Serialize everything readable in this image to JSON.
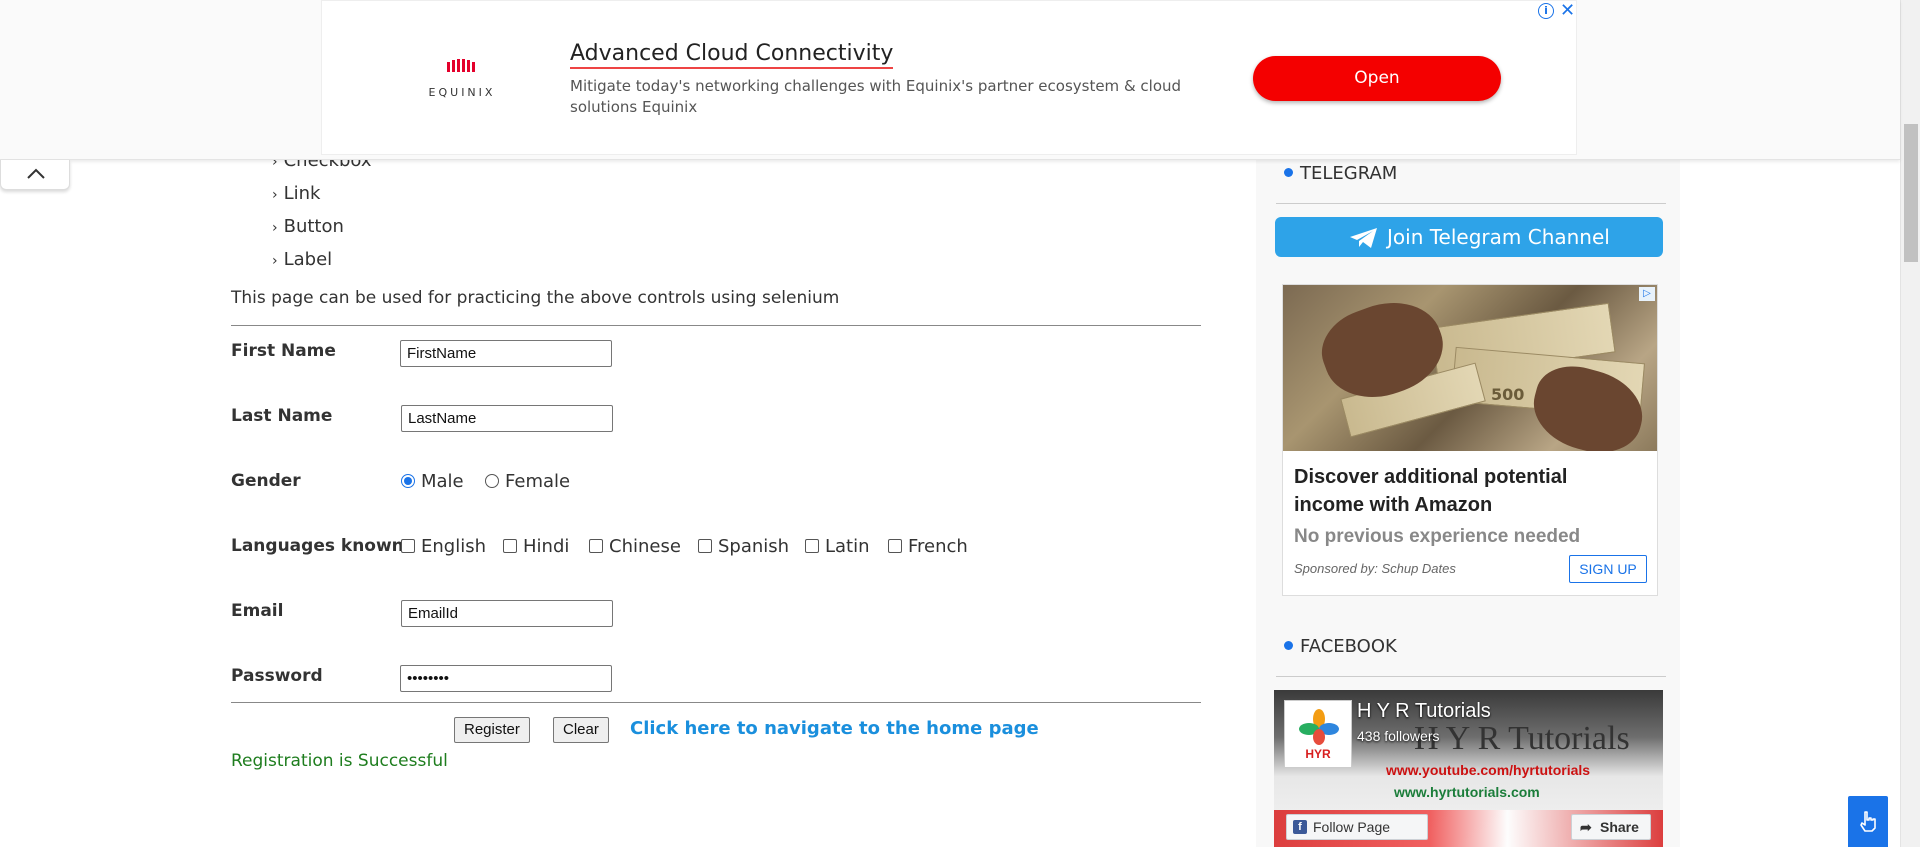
{
  "ad": {
    "logo_text": "EQUINIX",
    "title": "Advanced Cloud Connectivity",
    "description": "Mitigate today's networking challenges with Equinix's partner ecosystem & cloud solutions Equinix",
    "open_label": "Open",
    "info_glyph": "i",
    "close_glyph": "✕"
  },
  "nav_list": [
    {
      "label": "Checkbox"
    },
    {
      "label": "Link"
    },
    {
      "label": "Button"
    },
    {
      "label": "Label"
    }
  ],
  "intro": "This page can be used for practicing the above controls using selenium",
  "form": {
    "first_name_label": "First Name",
    "first_name_value": "FirstName",
    "last_name_label": "Last Name",
    "last_name_value": "LastName",
    "gender_label": "Gender",
    "gender_options": [
      {
        "label": "Male",
        "checked": true
      },
      {
        "label": "Female",
        "checked": false
      }
    ],
    "languages_label": "Languages known",
    "languages": [
      {
        "label": "English",
        "checked": false
      },
      {
        "label": "Hindi",
        "checked": false
      },
      {
        "label": "Chinese",
        "checked": false
      },
      {
        "label": "Spanish",
        "checked": false
      },
      {
        "label": "Latin",
        "checked": false
      },
      {
        "label": "French",
        "checked": false
      }
    ],
    "email_label": "Email",
    "email_value": "EmailId",
    "password_label": "Password",
    "password_value": "••••••••",
    "register_label": "Register",
    "clear_label": "Clear",
    "home_link": "Click here to navigate to the home page",
    "success_message": "Registration is Successful"
  },
  "sidebar": {
    "telegram_heading": "TELEGRAM",
    "telegram_button": "Join Telegram Channel",
    "amazon_ad": {
      "title": "Discover additional potential income with Amazon",
      "subtitle": "No previous experience needed",
      "sponsor": "Sponsored by: Schup Dates",
      "cta": "SIGN UP",
      "img_note": "500"
    },
    "facebook_heading": "FACEBOOK",
    "facebook": {
      "page_name": "H Y R Tutorials",
      "followers": "438 followers",
      "cover_title": "H Y R Tutorials",
      "url1": "www.youtube.com/hyrtutorials",
      "url2": "www.hyrtutorials.com",
      "logo_text": "HYR",
      "follow_label": "Follow Page",
      "share_label": "Share"
    }
  },
  "colors": {
    "accent": "#1a73e8",
    "ad_button": "#f40000",
    "telegram": "#2ea3e8",
    "success": "#1e7d1e",
    "link": "#1a8fdd"
  }
}
